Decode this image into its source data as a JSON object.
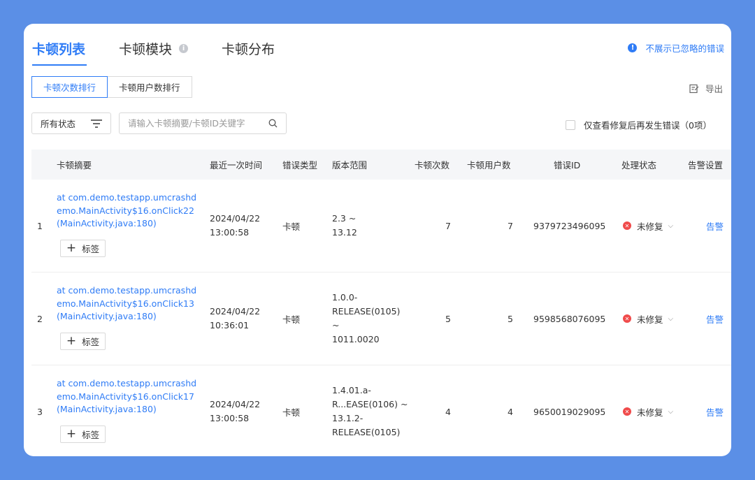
{
  "tabs": [
    {
      "label": "卡顿列表"
    },
    {
      "label": "卡顿模块"
    },
    {
      "label": "卡顿分布"
    }
  ],
  "ignore_toggle": "不展示已忽略的错误",
  "rank_tabs": [
    {
      "label": "卡顿次数排行"
    },
    {
      "label": "卡顿用户数排行"
    }
  ],
  "export_label": "导出",
  "status_filter": "所有状态",
  "search": {
    "placeholder": "请输入卡顿摘要/卡顿ID关键字"
  },
  "recur_filter": "仅查看修复后再发生错误（0项）",
  "columns": {
    "summary": "卡顿摘要",
    "time": "最近一次时间",
    "type": "错误类型",
    "version": "版本范围",
    "count": "卡顿次数",
    "users": "卡顿用户数",
    "id": "错误ID",
    "status": "处理状态",
    "alarm": "告警设置"
  },
  "tag_label": "标签",
  "rows": [
    {
      "index": "1",
      "summary": "at com.demo.testapp.umcrashdemo.MainActivity$16.onClick22(MainActivity.java:180)",
      "date": "2024/04/22",
      "time": "13:00:58",
      "type": "卡顿",
      "version": [
        "2.3 ~",
        "13.12"
      ],
      "count": "7",
      "users": "7",
      "id": "9379723496095",
      "status": "未修复",
      "alarm": "告警"
    },
    {
      "index": "2",
      "summary": "at com.demo.testapp.umcrashdemo.MainActivity$16.onClick13(MainActivity.java:180)",
      "date": "2024/04/22",
      "time": "10:36:01",
      "type": "卡顿",
      "version": [
        "1.0.0-",
        "RELEASE(0105) ~",
        "1011.0020"
      ],
      "count": "5",
      "users": "5",
      "id": "9598568076095",
      "status": "未修复",
      "alarm": "告警"
    },
    {
      "index": "3",
      "summary": "at com.demo.testapp.umcrashdemo.MainActivity$16.onClick17(MainActivity.java:180)",
      "date": "2024/04/22",
      "time": "13:00:58",
      "type": "卡顿",
      "version": [
        "1.4.01.a-",
        "R...EASE(0106) ~",
        "13.1.2-",
        "RELEASE(0105)"
      ],
      "count": "4",
      "users": "4",
      "id": "9650019029095",
      "status": "未修复",
      "alarm": "告警"
    }
  ]
}
